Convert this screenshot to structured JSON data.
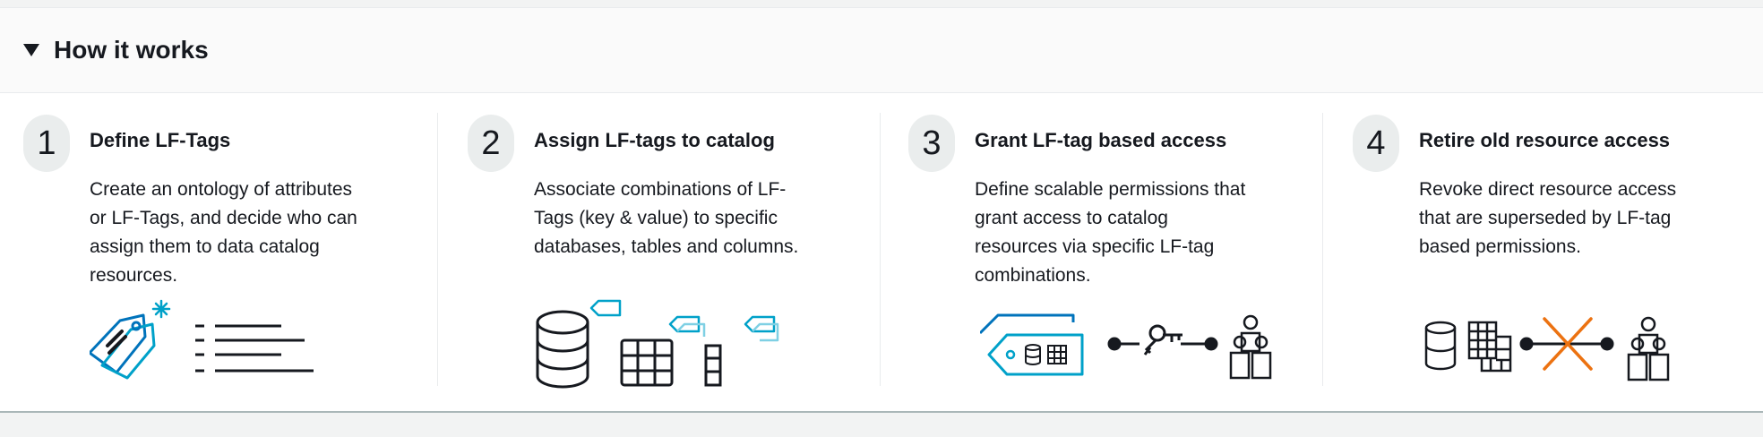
{
  "header": {
    "title": "How it works",
    "expand_icon": "caret-down-icon"
  },
  "steps": [
    {
      "number": "1",
      "title": "Define LF-Tags",
      "description_lines": [
        "Create an ontology of attributes",
        "or LF-Tags, and decide who can",
        "assign them to data catalog",
        "resources."
      ],
      "icon": "tags-list-icon"
    },
    {
      "number": "2",
      "title": "Assign LF-tags to catalog",
      "description_lines": [
        "Associate combinations of LF-",
        "Tags (key & value) to specific",
        "databases, tables and columns."
      ],
      "icon": "database-table-tags-icon"
    },
    {
      "number": "3",
      "title": "Grant LF-tag based access",
      "description_lines": [
        "Define scalable permissions that",
        "grant access to catalog",
        "resources via specific LF-tag",
        "combinations."
      ],
      "icon": "tag-key-users-icon"
    },
    {
      "number": "4",
      "title": "Retire old resource access",
      "description_lines": [
        "Revoke direct resource access",
        "that are superseded by LF-tag",
        "based permissions."
      ],
      "icon": "revoke-access-icon"
    }
  ],
  "colors": {
    "accent_blue": "#0073bb",
    "accent_teal": "#00a1c9",
    "revoke_orange": "#ec7211",
    "text": "#16191f"
  }
}
